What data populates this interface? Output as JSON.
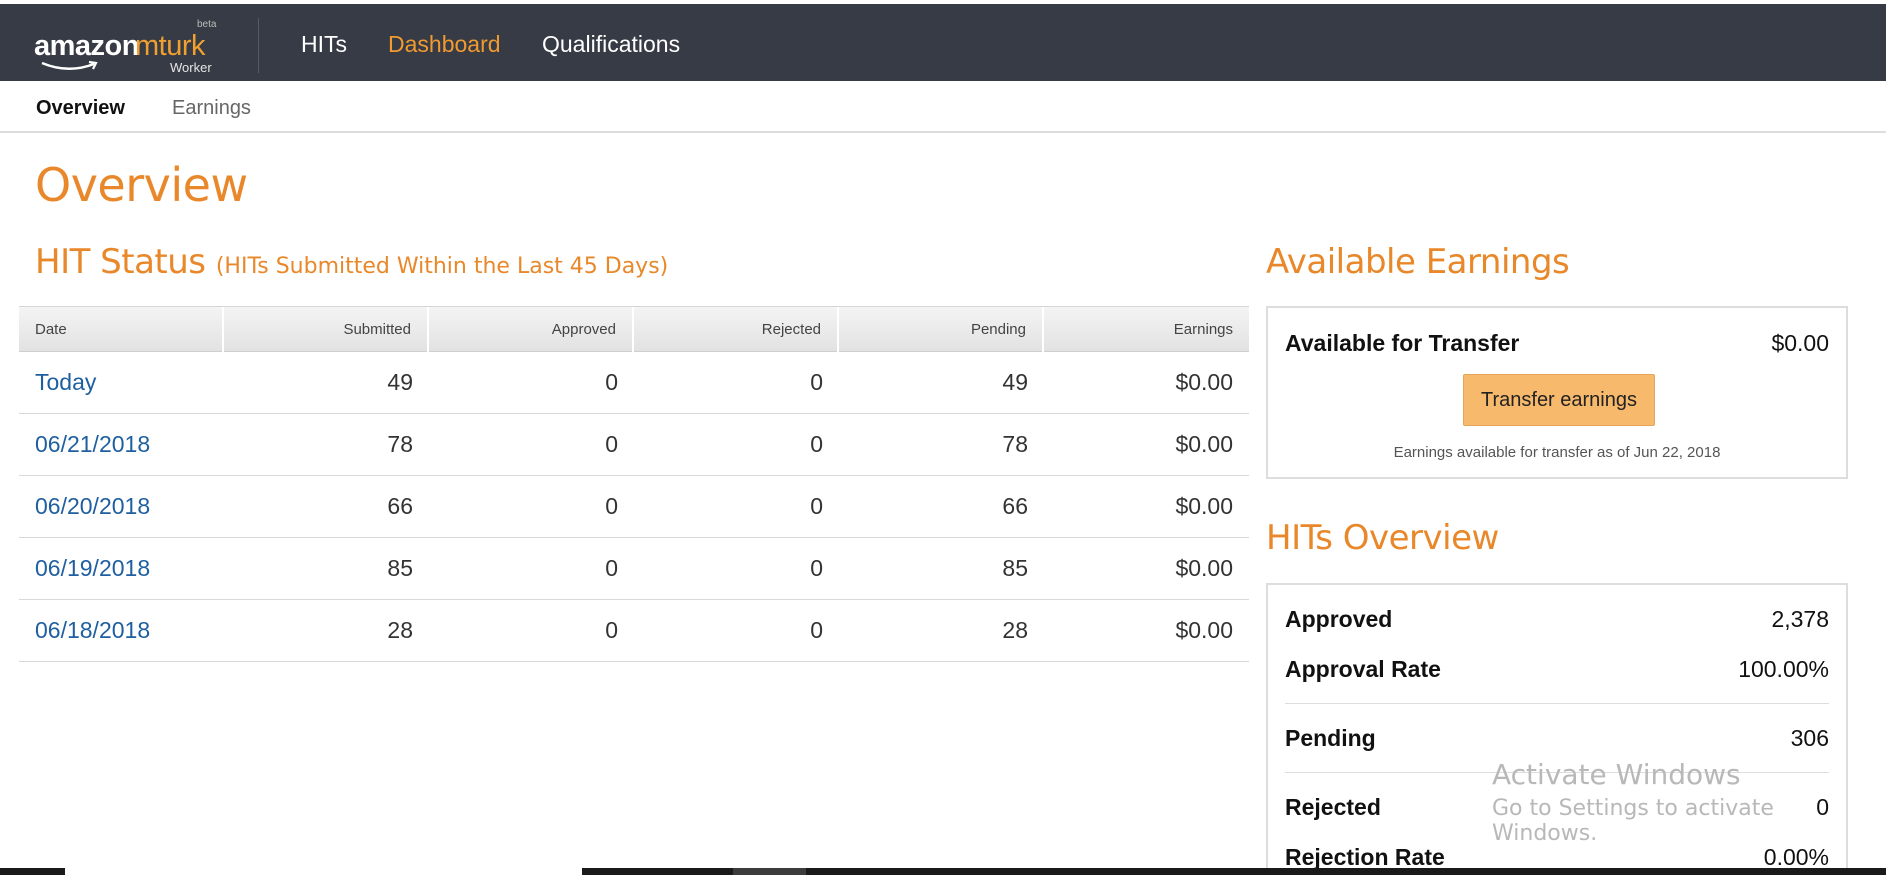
{
  "app": {
    "logo": {
      "word1": "amazon",
      "word2": "mturk",
      "beta": "beta",
      "sub": "Worker"
    },
    "nav": [
      {
        "label": "HITs",
        "active": false
      },
      {
        "label": "Dashboard",
        "active": true
      },
      {
        "label": "Qualifications",
        "active": false
      }
    ],
    "accent_color": "#f09a30",
    "topbar_color": "#363b45"
  },
  "subnav": {
    "tabs": [
      {
        "label": "Overview",
        "active": true
      },
      {
        "label": "Earnings",
        "active": false
      }
    ]
  },
  "page_title": "Overview",
  "hit_status": {
    "title": "HIT Status",
    "subtitle": "(HITs Submitted Within the Last 45 Days)",
    "columns": [
      "Date",
      "Submitted",
      "Approved",
      "Rejected",
      "Pending",
      "Earnings"
    ],
    "rows": [
      {
        "date": "Today",
        "submitted": "49",
        "approved": "0",
        "rejected": "0",
        "pending": "49",
        "earnings": "$0.00"
      },
      {
        "date": "06/21/2018",
        "submitted": "78",
        "approved": "0",
        "rejected": "0",
        "pending": "78",
        "earnings": "$0.00"
      },
      {
        "date": "06/20/2018",
        "submitted": "66",
        "approved": "0",
        "rejected": "0",
        "pending": "66",
        "earnings": "$0.00"
      },
      {
        "date": "06/19/2018",
        "submitted": "85",
        "approved": "0",
        "rejected": "0",
        "pending": "85",
        "earnings": "$0.00"
      },
      {
        "date": "06/18/2018",
        "submitted": "28",
        "approved": "0",
        "rejected": "0",
        "pending": "28",
        "earnings": "$0.00"
      }
    ]
  },
  "available_earnings": {
    "title": "Available Earnings",
    "label": "Available for Transfer",
    "value": "$0.00",
    "button": "Transfer earnings",
    "note": "Earnings available for transfer as of Jun 22, 2018"
  },
  "hits_overview": {
    "title": "HITs Overview",
    "items": [
      {
        "label": "Approved",
        "value": "2,378"
      },
      {
        "label": "Approval Rate",
        "value": "100.00%"
      },
      {
        "label": "Pending",
        "value": "306"
      },
      {
        "label": "Rejected",
        "value": "0"
      },
      {
        "label": "Rejection Rate",
        "value": "0.00%"
      }
    ]
  },
  "watermark": {
    "line1": "Activate Windows",
    "line2": "Go to Settings to activate Windows."
  }
}
